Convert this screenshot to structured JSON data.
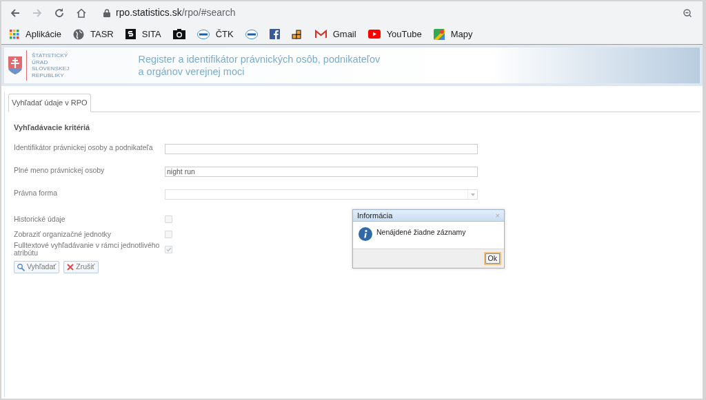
{
  "browser": {
    "url_host": "rpo.statistics.sk",
    "url_path": "/rpo/#search",
    "bookmarks": [
      {
        "kind": "apps",
        "label": "Aplikácie"
      },
      {
        "kind": "globe",
        "label": "TASR"
      },
      {
        "kind": "s",
        "label": "SITA"
      },
      {
        "kind": "camera"
      },
      {
        "kind": "ctk",
        "label": "ČTK"
      },
      {
        "kind": "ctk"
      },
      {
        "kind": "facebook"
      },
      {
        "kind": "blocks"
      },
      {
        "kind": "gmail",
        "label": "Gmail"
      },
      {
        "kind": "youtube",
        "label": "YouTube"
      },
      {
        "kind": "maps",
        "label": "Mapy"
      }
    ]
  },
  "header": {
    "logo_lines": [
      "ŠTATISTICKÝ",
      "ÚRAD",
      "SLOVENSKEJ",
      "REPUBLIKY"
    ],
    "title_lines": [
      "Register a identifikátor právnických osôb, podnikateľov",
      "a orgánov verejnej moci"
    ]
  },
  "tabs": [
    {
      "label": "Vyhľadať údaje v RPO",
      "selected": true
    }
  ],
  "form": {
    "heading": "Vyhľadávacie kritériá",
    "fields": [
      {
        "kind": "text",
        "label": "Identifikátor právnickej osoby a podnikateľa"
      },
      {
        "kind": "text",
        "label": "Plné meno právnickej osoby",
        "value": "night run"
      },
      {
        "kind": "select",
        "label": "Právna forma"
      }
    ],
    "checkboxes": [
      {
        "label": "Historické údaje",
        "checked": false
      },
      {
        "label": "Zobraziť organizačné jednotky",
        "checked": false
      },
      {
        "label": "Fulltextové vyhľadávanie v rámci jednotlivého atribútu",
        "checked": true
      }
    ],
    "buttons": [
      {
        "kind": "search",
        "label": "Vyhľadať"
      },
      {
        "kind": "cancel",
        "label": "Zrušiť"
      }
    ]
  },
  "dialog": {
    "title": "Informácia",
    "close": "×",
    "message": "Nenájdené žiadne záznamy",
    "button": "Ok"
  }
}
